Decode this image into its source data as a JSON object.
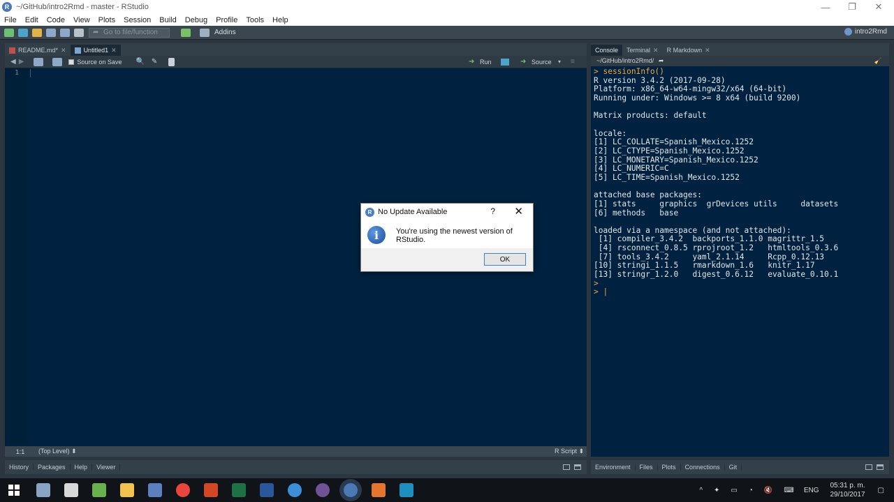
{
  "window": {
    "title": "~/GitHub/intro2Rmd - master - RStudio",
    "minimize": "—",
    "restore": "❐",
    "close": "✕"
  },
  "menu": [
    "File",
    "Edit",
    "Code",
    "View",
    "Plots",
    "Session",
    "Build",
    "Debug",
    "Profile",
    "Tools",
    "Help"
  ],
  "toolbar": {
    "goto_placeholder": "Go to file/function",
    "addins": "Addins",
    "project": "intro2Rmd"
  },
  "editor": {
    "tabs": [
      {
        "label": "README.md*"
      },
      {
        "label": "Untitled1"
      }
    ],
    "source_on_save": "Source on Save",
    "run": "Run",
    "source": "Source",
    "line_number": "1",
    "status_position": "1:1",
    "status_scope": "(Top Level) ⬍",
    "status_filetype": "R Script ⬍"
  },
  "bottom_left_tabs": [
    "History",
    "Packages",
    "Help",
    "Viewer"
  ],
  "console": {
    "tabs": [
      "Console",
      "Terminal",
      "R Markdown"
    ],
    "path": "~/GitHub/intro2Rmd/",
    "lines": [
      "> sessionInfo()",
      "R version 3.4.2 (2017-09-28)",
      "Platform: x86_64-w64-mingw32/x64 (64-bit)",
      "Running under: Windows >= 8 x64 (build 9200)",
      "",
      "Matrix products: default",
      "",
      "locale:",
      "[1] LC_COLLATE=Spanish_Mexico.1252",
      "[2] LC_CTYPE=Spanish_Mexico.1252",
      "[3] LC_MONETARY=Spanish_Mexico.1252",
      "[4] LC_NUMERIC=C",
      "[5] LC_TIME=Spanish_Mexico.1252",
      "",
      "attached base packages:",
      "[1] stats     graphics  grDevices utils     datasets",
      "[6] methods   base",
      "",
      "loaded via a namespace (and not attached):",
      " [1] compiler_3.4.2  backports_1.1.0 magrittr_1.5",
      " [4] rsconnect_0.8.5 rprojroot_1.2   htmltools_0.3.6",
      " [7] tools_3.4.2     yaml_2.1.14     Rcpp_0.12.13",
      "[10] stringi_1.1.5   rmarkdown_1.6   knitr_1.17",
      "[13] stringr_1.2.0   digest_0.6.12   evaluate_0.10.1",
      ">",
      "> |"
    ]
  },
  "bottom_right_tabs": [
    "Environment",
    "Files",
    "Plots",
    "Connections",
    "Git"
  ],
  "dialog": {
    "title": "No Update Available",
    "help": "?",
    "close": "✕",
    "message": "You're using the newest version of RStudio.",
    "ok": "OK",
    "icon": "i"
  },
  "taskbar": {
    "lang": "ENG",
    "time": "05:31 p. m.",
    "date": "29/10/2017"
  },
  "colors": {
    "editor_bg": "#002240",
    "pane_chrome": "#33404a",
    "console_prompt": "#f0a540"
  }
}
